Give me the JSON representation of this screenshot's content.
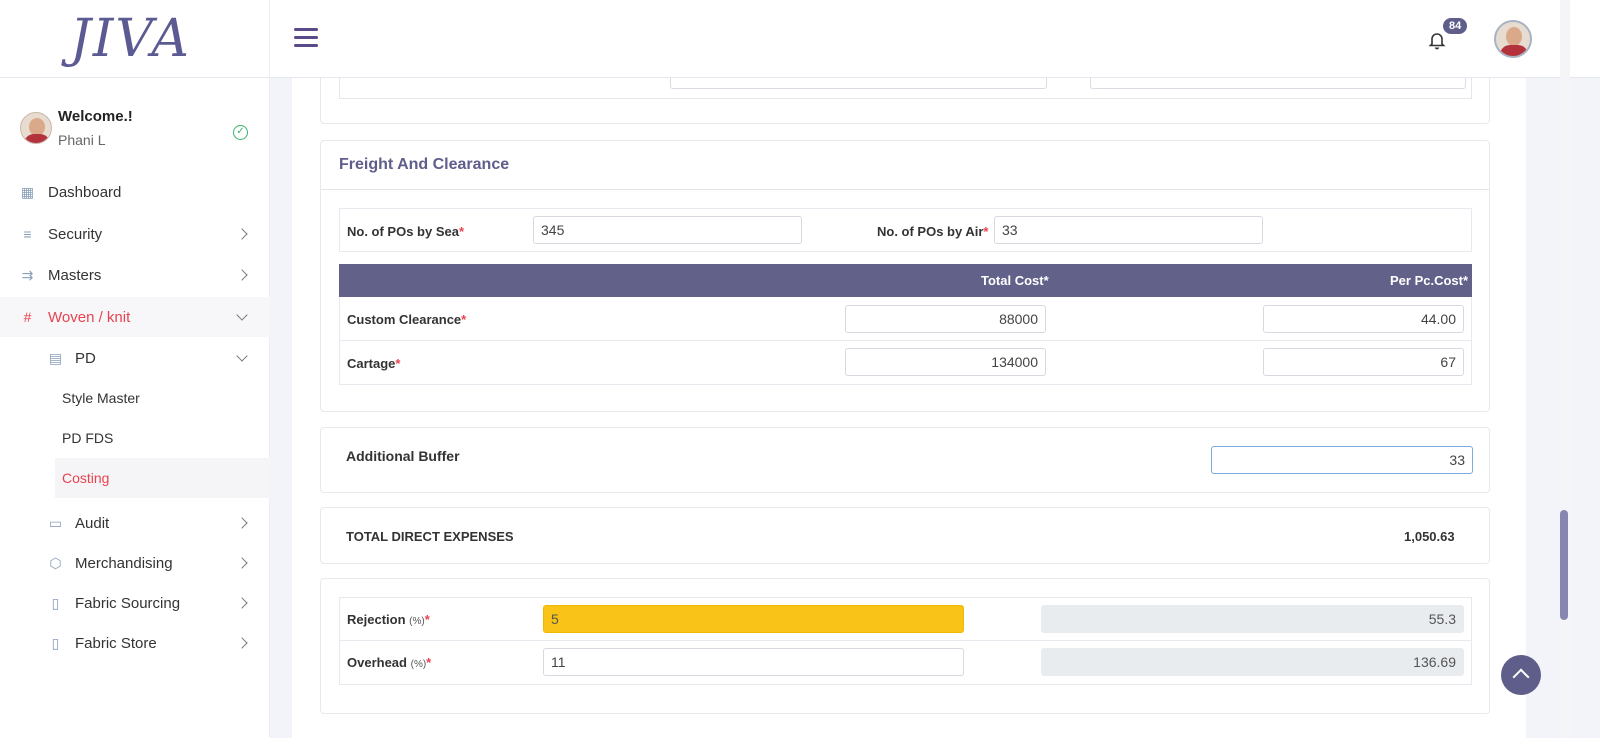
{
  "app": {
    "logo": "JIVA"
  },
  "user": {
    "welcome": "Welcome.!",
    "name": "Phani L"
  },
  "notifications": {
    "count": "84"
  },
  "sidebar": {
    "items": [
      {
        "label": "Dashboard",
        "icon": "grid-icon"
      },
      {
        "label": "Security",
        "icon": "sliders-icon"
      },
      {
        "label": "Masters",
        "icon": "fast-forward-icon"
      },
      {
        "label": "Woven / knit",
        "icon": "hash-grid-icon",
        "active": true
      }
    ],
    "sub": {
      "pd": {
        "label": "PD",
        "icon": "table-icon"
      },
      "leaves": [
        "Style Master",
        "PD FDS",
        "Costing"
      ],
      "audit": {
        "label": "Audit",
        "icon": "card-icon"
      },
      "merchandising": {
        "label": "Merchandising",
        "icon": "hexagon-icon"
      },
      "fabric_sourcing": {
        "label": "Fabric Sourcing",
        "icon": "receipt-icon"
      },
      "fabric_store": {
        "label": "Fabric Store",
        "icon": "receipt-icon"
      }
    }
  },
  "freight": {
    "title": "Freight And Clearance",
    "pos_by_sea_label": "No. of POs by Sea",
    "pos_by_sea_value": "345",
    "pos_by_air_label": "No. of POs by Air",
    "pos_by_air_value": "33",
    "columns": {
      "total_cost": "Total Cost*",
      "per_pc_cost": "Per Pc.Cost*"
    },
    "rows": [
      {
        "label": "Custom Clearance",
        "total": "88000",
        "per_pc": "44.00"
      },
      {
        "label": "Cartage",
        "total": "134000",
        "per_pc": "67"
      }
    ]
  },
  "buffer": {
    "label": "Additional Buffer",
    "value": "33"
  },
  "total_direct": {
    "label": "TOTAL DIRECT EXPENSES",
    "value": "1,050.63"
  },
  "rejection": {
    "label": "Rejection",
    "unit": "(%)",
    "value": "5",
    "computed": "55.3"
  },
  "overhead": {
    "label": "Overhead",
    "unit": "(%)",
    "value": "11",
    "computed": "136.69"
  },
  "colors": {
    "primary": "#62618a",
    "danger": "#e8434f",
    "highlight": "#f9c417"
  }
}
